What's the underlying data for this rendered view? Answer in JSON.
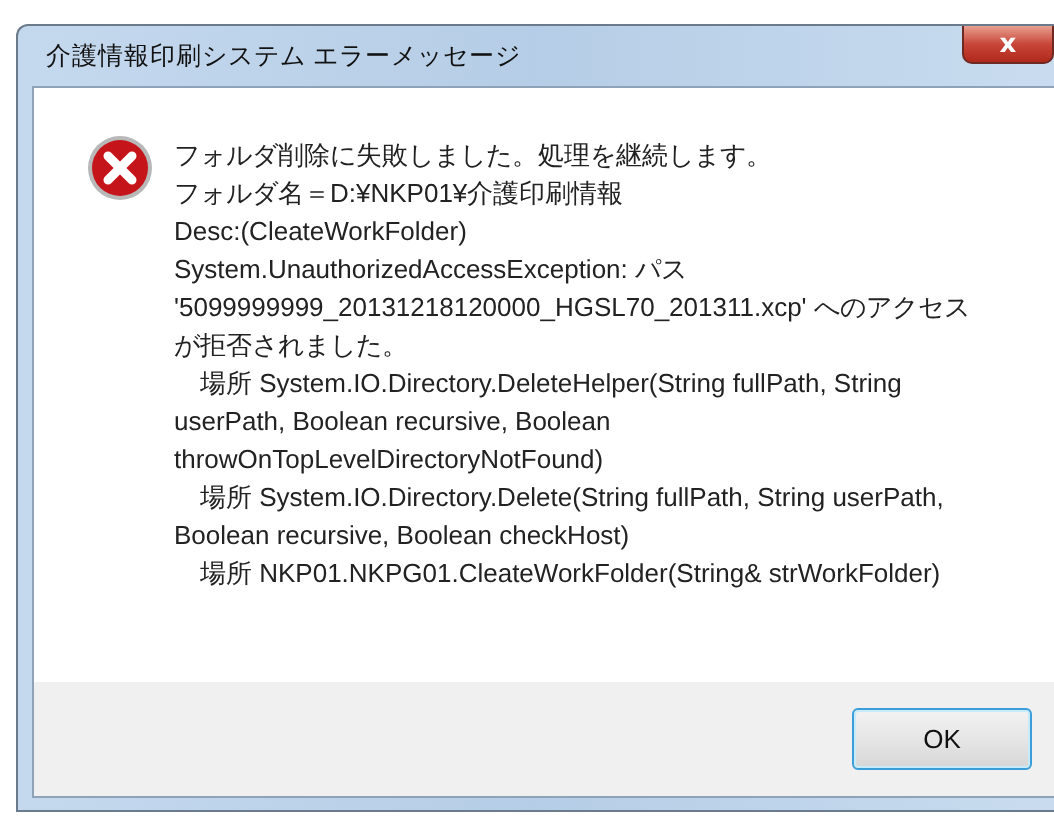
{
  "window": {
    "title": "介護情報印刷システム エラーメッセージ",
    "close_label": "x"
  },
  "message": {
    "kind": "error",
    "lines": [
      "フォルダ削除に失敗しました。処理を継続します。",
      "フォルダ名＝D:¥NKP01¥介護印刷情報",
      "Desc:(CleateWorkFolder)",
      "System.UnauthorizedAccessException: パス '5099999999_20131218120000_HGSL70_201311.xcp' へのアクセスが拒否されました。",
      "　場所 System.IO.Directory.DeleteHelper(String fullPath, String userPath, Boolean recursive, Boolean throwOnTopLevelDirectoryNotFound)",
      "　場所 System.IO.Directory.Delete(String fullPath, String userPath, Boolean recursive, Boolean checkHost)",
      "　場所 NKP01.NKPG01.CleateWorkFolder(String& strWorkFolder)"
    ]
  },
  "buttons": [
    "OK"
  ]
}
